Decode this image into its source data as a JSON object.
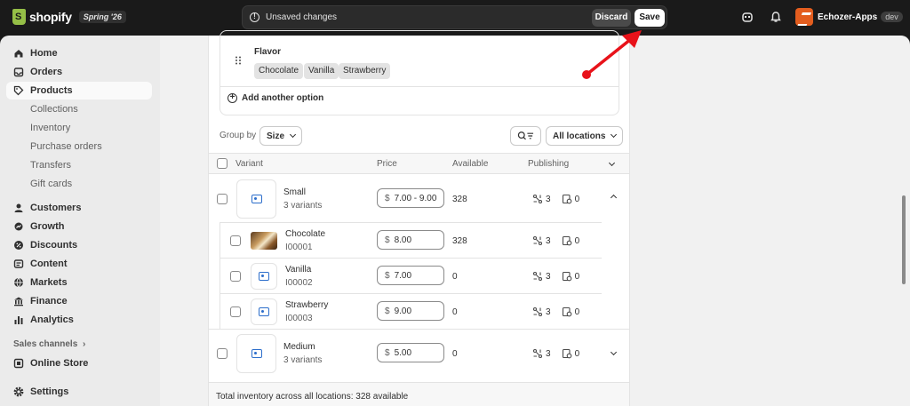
{
  "topbar": {
    "logo_text": "shopify",
    "edition_badge": "Spring '26",
    "unsaved_text": "Unsaved changes",
    "discard_label": "Discard",
    "save_label": "Save",
    "store_name": "Echozer-Apps",
    "store_tag": "dev"
  },
  "sidebar": {
    "items": [
      {
        "label": "Home",
        "icon": "home-icon"
      },
      {
        "label": "Orders",
        "icon": "inbox-icon"
      },
      {
        "label": "Products",
        "icon": "tag-icon"
      }
    ],
    "product_subitems": [
      "Collections",
      "Inventory",
      "Purchase orders",
      "Transfers",
      "Gift cards"
    ],
    "items2": [
      {
        "label": "Customers",
        "icon": "person-icon"
      },
      {
        "label": "Growth",
        "icon": "growth-icon"
      },
      {
        "label": "Discounts",
        "icon": "discount-icon"
      },
      {
        "label": "Content",
        "icon": "content-icon"
      },
      {
        "label": "Markets",
        "icon": "globe-icon"
      },
      {
        "label": "Finance",
        "icon": "bank-icon"
      },
      {
        "label": "Analytics",
        "icon": "chart-bar-icon"
      }
    ],
    "sales_channels_label": "Sales channels",
    "online_store_label": "Online Store",
    "settings_label": "Settings"
  },
  "options": {
    "option_name": "Flavor",
    "values": [
      "Chocolate",
      "Vanilla",
      "Strawberry"
    ],
    "add_option_label": "Add another option"
  },
  "toolbar": {
    "group_by_label": "Group by",
    "group_by_value": "Size",
    "locations_label": "All locations"
  },
  "table": {
    "headers": {
      "variant": "Variant",
      "price": "Price",
      "available": "Available",
      "publishing": "Publishing"
    },
    "groups": [
      {
        "name": "Small",
        "sub": "3 variants",
        "price": "7.00 - 9.00",
        "available": "328",
        "channels": "3",
        "catalogs": "0",
        "children": [
          {
            "name": "Chocolate",
            "sku": "I00001",
            "price": "8.00",
            "available": "328",
            "channels": "3",
            "catalogs": "0"
          },
          {
            "name": "Vanilla",
            "sku": "I00002",
            "price": "7.00",
            "available": "0",
            "channels": "3",
            "catalogs": "0"
          },
          {
            "name": "Strawberry",
            "sku": "I00003",
            "price": "9.00",
            "available": "0",
            "channels": "3",
            "catalogs": "0"
          }
        ]
      },
      {
        "name": "Medium",
        "sub": "3 variants",
        "price": "5.00",
        "available": "0",
        "channels": "3",
        "catalogs": "0"
      }
    ],
    "currency": "$",
    "footer": "Total inventory across all locations: 328 available"
  },
  "colors": {
    "annotation_arrow": "#e8121a",
    "brand_green": "#95bf47",
    "store_logo": "#e35d1e"
  }
}
